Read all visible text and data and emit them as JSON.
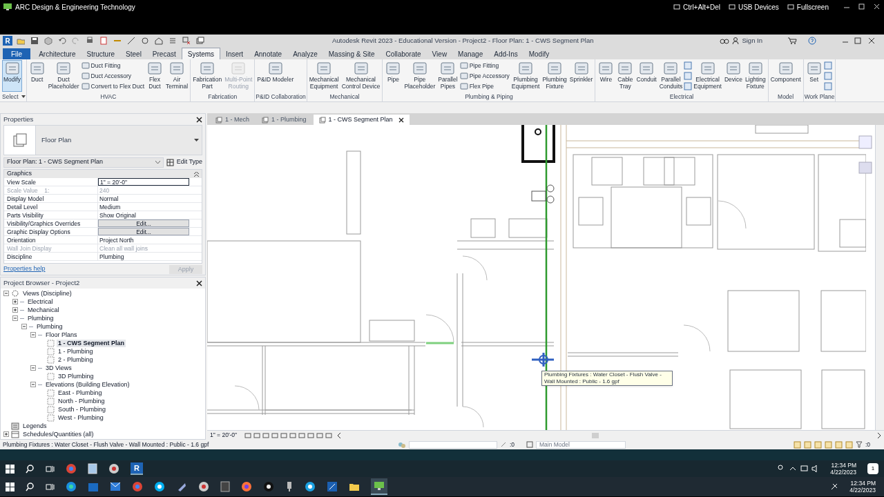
{
  "host_bar": {
    "title": "ARC Design & Engineering Technology",
    "buttons": [
      "Ctrl+Alt+Del",
      "USB Devices",
      "Fullscreen"
    ]
  },
  "app": {
    "logo": "R",
    "title": "Autodesk Revit 2023 - Educational Version - Project2 - Floor Plan: 1 - CWS Segment Plan",
    "sign_in": "Sign In"
  },
  "ribbon_tabs": [
    {
      "label": "File",
      "kind": "file",
      "selected": false
    },
    {
      "label": "Architecture",
      "kind": "tab",
      "selected": false
    },
    {
      "label": "Structure",
      "kind": "tab",
      "selected": false
    },
    {
      "label": "Steel",
      "kind": "tab",
      "selected": false
    },
    {
      "label": "Precast",
      "kind": "tab",
      "selected": false
    },
    {
      "label": "Systems",
      "kind": "tab",
      "selected": true
    },
    {
      "label": "Insert",
      "kind": "tab",
      "selected": false
    },
    {
      "label": "Annotate",
      "kind": "tab",
      "selected": false
    },
    {
      "label": "Analyze",
      "kind": "tab",
      "selected": false
    },
    {
      "label": "Massing & Site",
      "kind": "tab",
      "selected": false
    },
    {
      "label": "Collaborate",
      "kind": "tab",
      "selected": false
    },
    {
      "label": "View",
      "kind": "tab",
      "selected": false
    },
    {
      "label": "Manage",
      "kind": "tab",
      "selected": false
    },
    {
      "label": "Add-Ins",
      "kind": "tab",
      "selected": false
    },
    {
      "label": "Modify",
      "kind": "tab",
      "selected": false
    }
  ],
  "ribbon_panels": [
    {
      "label": "Select",
      "menu": true,
      "tools": [
        {
          "kind": "large",
          "label": "Modify",
          "selected": true,
          "disabled": false
        }
      ]
    },
    {
      "label": "HVAC",
      "menu": false,
      "tools": [
        {
          "kind": "large",
          "label": "Duct",
          "selected": false,
          "disabled": false
        },
        {
          "kind": "large",
          "label": "Duct\nPlaceholder",
          "selected": false,
          "disabled": false
        },
        {
          "kind": "stack",
          "items": [
            "Duct Fitting",
            "Duct Accessory",
            "Convert to Flex Duct"
          ]
        },
        {
          "kind": "large",
          "label": "Flex\nDuct",
          "selected": false,
          "disabled": false
        },
        {
          "kind": "large",
          "label": "Air\nTerminal",
          "selected": false,
          "disabled": false
        }
      ]
    },
    {
      "label": "Fabrication",
      "menu": false,
      "tools": [
        {
          "kind": "large",
          "label": "Fabrication\nPart",
          "selected": false,
          "disabled": false
        },
        {
          "kind": "large",
          "label": "Multi-Point\nRouting",
          "selected": false,
          "disabled": true
        }
      ]
    },
    {
      "label": "P&ID Collaboration",
      "menu": false,
      "tools": [
        {
          "kind": "large",
          "label": "P&ID Modeler",
          "selected": false,
          "disabled": false
        }
      ]
    },
    {
      "label": "Mechanical",
      "menu": false,
      "tools": [
        {
          "kind": "large",
          "label": "Mechanical\nEquipment",
          "selected": false,
          "disabled": false
        },
        {
          "kind": "large",
          "label": "Mechanical\nControl Device",
          "selected": false,
          "disabled": false
        }
      ]
    },
    {
      "label": "Plumbing & Piping",
      "menu": false,
      "tools": [
        {
          "kind": "large",
          "label": "Pipe",
          "selected": false,
          "disabled": false
        },
        {
          "kind": "large",
          "label": "Pipe\nPlaceholder",
          "selected": false,
          "disabled": false
        },
        {
          "kind": "large",
          "label": "Parallel\nPipes",
          "selected": false,
          "disabled": false
        },
        {
          "kind": "stack",
          "items": [
            "Pipe Fitting",
            "Pipe Accessory",
            "Flex Pipe"
          ]
        },
        {
          "kind": "large",
          "label": "Plumbing\nEquipment",
          "selected": false,
          "disabled": false
        },
        {
          "kind": "large",
          "label": "Plumbing\nFixture",
          "selected": false,
          "disabled": false
        },
        {
          "kind": "large",
          "label": "Sprinkler",
          "selected": false,
          "disabled": false
        }
      ]
    },
    {
      "label": "Electrical",
      "menu": false,
      "tools": [
        {
          "kind": "large",
          "label": "Wire",
          "selected": false,
          "disabled": false
        },
        {
          "kind": "large",
          "label": "Cable\nTray",
          "selected": false,
          "disabled": false
        },
        {
          "kind": "large",
          "label": "Conduit",
          "selected": false,
          "disabled": false
        },
        {
          "kind": "large",
          "label": "Parallel\nConduits",
          "selected": false,
          "disabled": false
        },
        {
          "kind": "icons"
        },
        {
          "kind": "large",
          "label": "Electrical\nEquipment",
          "selected": false,
          "disabled": false
        },
        {
          "kind": "large",
          "label": "Device",
          "selected": false,
          "disabled": false
        },
        {
          "kind": "large",
          "label": "Lighting\nFixture",
          "selected": false,
          "disabled": false
        }
      ]
    },
    {
      "label": "Model",
      "menu": false,
      "tools": [
        {
          "kind": "large",
          "label": "Component",
          "selected": false,
          "disabled": false
        }
      ]
    },
    {
      "label": "Work Plane",
      "menu": false,
      "tools": [
        {
          "kind": "large",
          "label": "Set",
          "selected": false,
          "disabled": false
        },
        {
          "kind": "icons"
        }
      ]
    }
  ],
  "properties": {
    "title": "Properties",
    "type_name": "Floor Plan",
    "instance": "Floor Plan: 1 - CWS Segment Plan",
    "edit_type": "Edit Type",
    "group": "Graphics",
    "rows": [
      {
        "name": "View Scale",
        "value": "1\" = 20'-0\"",
        "kind": "field",
        "disabled": false
      },
      {
        "name": "Scale Value    1:",
        "value": "240",
        "kind": "text",
        "disabled": true
      },
      {
        "name": "Display Model",
        "value": "Normal",
        "kind": "text",
        "disabled": false
      },
      {
        "name": "Detail Level",
        "value": "Medium",
        "kind": "text",
        "disabled": false
      },
      {
        "name": "Parts Visibility",
        "value": "Show Original",
        "kind": "text",
        "disabled": false
      },
      {
        "name": "Visibility/Graphics Overrides",
        "value": "Edit...",
        "kind": "button",
        "disabled": false
      },
      {
        "name": "Graphic Display Options",
        "value": "Edit...",
        "kind": "button",
        "disabled": false
      },
      {
        "name": "Orientation",
        "value": "Project North",
        "kind": "text",
        "disabled": false
      },
      {
        "name": "Wall Join Display",
        "value": "Clean all wall joins",
        "kind": "text",
        "disabled": true
      },
      {
        "name": "Discipline",
        "value": "Plumbing",
        "kind": "text",
        "disabled": false
      }
    ],
    "help": "Properties help",
    "apply": "Apply"
  },
  "project_browser": {
    "title": "Project Browser - Project2",
    "tree": [
      {
        "label": "Views (Discipline)",
        "kind": "views",
        "expanded": true,
        "selected": false,
        "children": [
          {
            "label": "Electrical",
            "kind": "group",
            "expanded": false,
            "selected": false
          },
          {
            "label": "Mechanical",
            "kind": "group",
            "expanded": false,
            "selected": false
          },
          {
            "label": "Plumbing",
            "kind": "group",
            "expanded": true,
            "selected": false,
            "children": [
              {
                "label": "Plumbing",
                "kind": "group",
                "expanded": true,
                "selected": false,
                "children": [
                  {
                    "label": "Floor Plans",
                    "kind": "group",
                    "expanded": true,
                    "selected": false,
                    "children": [
                      {
                        "label": "1 - CWS Segment Plan",
                        "kind": "view",
                        "selected": true
                      },
                      {
                        "label": "1 - Plumbing",
                        "kind": "view",
                        "selected": false
                      },
                      {
                        "label": "2 - Plumbing",
                        "kind": "view",
                        "selected": false
                      }
                    ]
                  },
                  {
                    "label": "3D Views",
                    "kind": "group",
                    "expanded": true,
                    "selected": false,
                    "children": [
                      {
                        "label": "3D Plumbing",
                        "kind": "view",
                        "selected": false
                      }
                    ]
                  },
                  {
                    "label": "Elevations (Building Elevation)",
                    "kind": "group",
                    "expanded": true,
                    "selected": false,
                    "children": [
                      {
                        "label": "East - Plumbing",
                        "kind": "view",
                        "selected": false
                      },
                      {
                        "label": "North - Plumbing",
                        "kind": "view",
                        "selected": false
                      },
                      {
                        "label": "South - Plumbing",
                        "kind": "view",
                        "selected": false
                      },
                      {
                        "label": "West - Plumbing",
                        "kind": "view",
                        "selected": false
                      }
                    ]
                  }
                ]
              }
            ]
          }
        ]
      },
      {
        "label": "Legends",
        "kind": "legend",
        "selected": false
      },
      {
        "label": "Schedules/Quantities (all)",
        "kind": "schedule",
        "expanded": false,
        "selected": false
      }
    ]
  },
  "view_tabs": [
    {
      "label": "1 - Mech",
      "selected": false
    },
    {
      "label": "1 - Plumbing",
      "selected": false
    },
    {
      "label": "1 - CWS Segment Plan",
      "selected": true
    }
  ],
  "tooltip": "Plumbing Fixtures : Water Closet - Flush Valve - Wall Mounted : Public - 1.6 gpf",
  "view_scale": "1\" = 20'-0\"",
  "status_bar": {
    "message": "Plumbing Fixtures : Water Closet - Flush Valve - Wall Mounted : Public - 1.6 gpf",
    "select_count": ":0",
    "model": "Main Model",
    "filter_count": ":0"
  },
  "remote_taskbar": {
    "app_letter": "R",
    "time": "12:34 PM",
    "date": "4/22/2023",
    "notifications": "1"
  },
  "local_taskbar": {
    "time": "12:34 PM",
    "date": "4/22/2023"
  }
}
